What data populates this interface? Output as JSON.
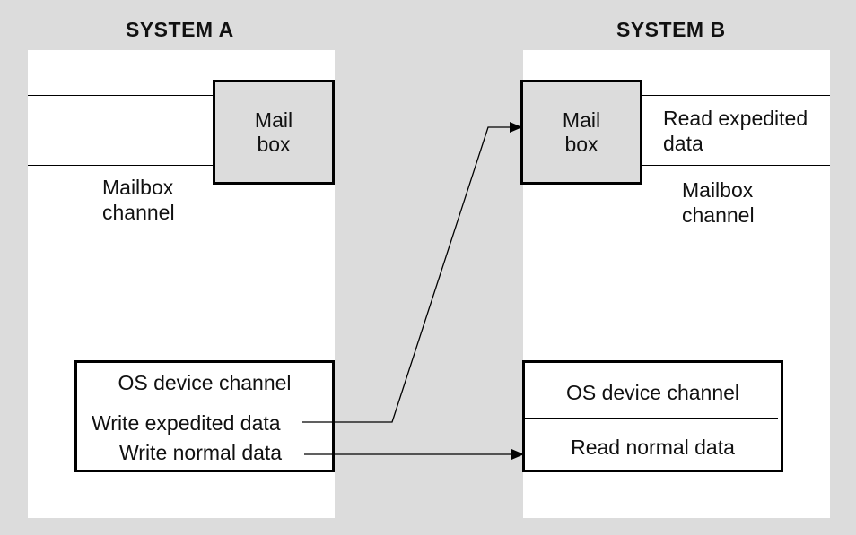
{
  "system_a": {
    "title": "SYSTEM A",
    "mailbox": {
      "line1": "Mail",
      "line2": "box"
    },
    "channel_label": {
      "line1": "Mailbox",
      "line2": "channel"
    },
    "os_box": {
      "header": "OS device channel",
      "write_expedited": "Write expedited data",
      "write_normal": "Write normal data"
    }
  },
  "system_b": {
    "title": "SYSTEM B",
    "mailbox": {
      "line1": "Mail",
      "line2": "box"
    },
    "read_expedited": {
      "line1": "Read expedited",
      "line2": "data"
    },
    "channel_label": {
      "line1": "Mailbox",
      "line2": "channel"
    },
    "os_box": {
      "header": "OS device channel",
      "read_normal": "Read normal data"
    }
  },
  "colors": {
    "background": "#dcdcdc",
    "panel": "#ffffff",
    "mailbox_fill": "#dcdcdc",
    "stroke": "#000000"
  }
}
